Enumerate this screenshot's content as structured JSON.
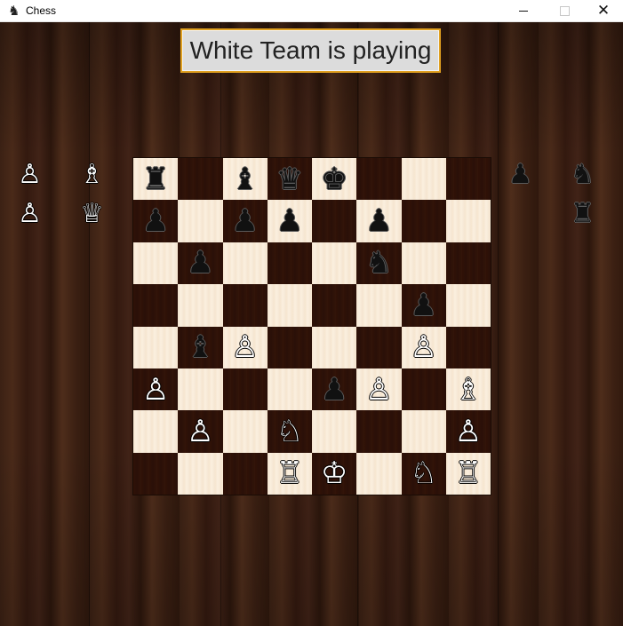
{
  "window": {
    "title": "Chess",
    "app_icon": "chess-knight-icon",
    "controls": [
      "minimize-icon",
      "maximize-icon",
      "close-icon"
    ]
  },
  "status_label": "White Team is playing",
  "colors": {
    "light_square": "#fbefdf",
    "dark_square": "#2a1008",
    "status_bg": "#dcdcdc",
    "status_border": "#e0a020",
    "wood": "#3a2012"
  },
  "board": {
    "rows": [
      [
        "bR",
        "",
        "bB",
        "bQ",
        "bK",
        "",
        "",
        ""
      ],
      [
        "bP",
        "",
        "bP",
        "bP",
        "",
        "bP",
        "",
        ""
      ],
      [
        "",
        "bP",
        "",
        "",
        "",
        "bN",
        "",
        ""
      ],
      [
        "",
        "",
        "",
        "",
        "",
        "",
        "bP",
        ""
      ],
      [
        "",
        "bB",
        "wP",
        "",
        "",
        "",
        "wP",
        ""
      ],
      [
        "wP",
        "",
        "",
        "",
        "bP",
        "wP",
        "",
        "wB"
      ],
      [
        "",
        "wP",
        "",
        "wN",
        "",
        "",
        "",
        "wP"
      ],
      [
        "",
        "",
        "",
        "wR",
        "wK",
        "",
        "wN",
        "wR"
      ]
    ]
  },
  "captured_by_left": [
    [
      "wP",
      "wB"
    ],
    [
      "wP",
      "wQ"
    ]
  ],
  "captured_by_right": [
    [
      "bP",
      "bN"
    ],
    [
      "",
      "bR"
    ]
  ],
  "glyphs": {
    "wK": "♔",
    "wQ": "♕",
    "wR": "♖",
    "wB": "♗",
    "wN": "♘",
    "wP": "♙",
    "bK": "♚",
    "bQ": "♛",
    "bR": "♜",
    "bB": "♝",
    "bN": "♞",
    "bP": "♟"
  },
  "piece_names": {
    "K": "king",
    "Q": "queen",
    "R": "rook",
    "B": "bishop",
    "N": "knight",
    "P": "pawn"
  }
}
